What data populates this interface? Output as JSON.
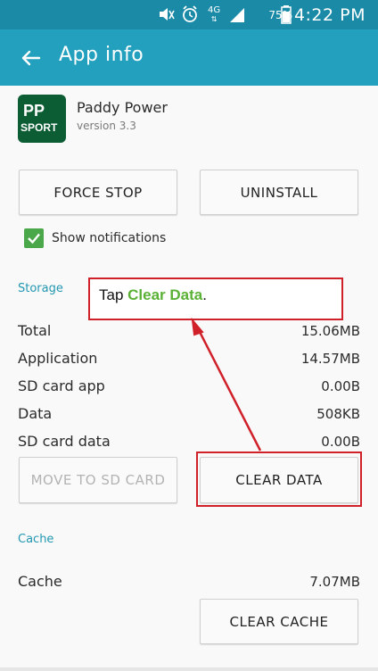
{
  "status_bar": {
    "time": "4:22 PM",
    "battery_percent": "75%",
    "network": "4G",
    "icons": [
      "mute-icon",
      "alarm-icon",
      "network-4g-icon",
      "signal-icon",
      "battery-icon"
    ]
  },
  "app_bar": {
    "title": "App info",
    "back_icon": "arrow-left-icon",
    "background": "#22a0bd"
  },
  "app": {
    "name": "Paddy Power",
    "version": "version 3.3",
    "icon_text_top": "PP",
    "icon_text_bottom": "SPORT",
    "icon_color": "#0c5d34"
  },
  "buttons": {
    "force_stop": "FORCE STOP",
    "uninstall": "UNINSTALL",
    "move_to_sd": "MOVE TO SD CARD",
    "clear_data": "CLEAR DATA",
    "clear_cache": "CLEAR CACHE"
  },
  "notifications": {
    "label": "Show notifications",
    "checked": true
  },
  "storage": {
    "section_label": "Storage",
    "rows": [
      {
        "label": "Total",
        "value": "15.06MB"
      },
      {
        "label": "Application",
        "value": "14.57MB"
      },
      {
        "label": "SD card app",
        "value": "0.00B"
      },
      {
        "label": "Data",
        "value": "508KB"
      },
      {
        "label": "SD card data",
        "value": "0.00B"
      }
    ]
  },
  "cache": {
    "section_label": "Cache",
    "rows": [
      {
        "label": "Cache",
        "value": "7.07MB"
      }
    ]
  },
  "annotation": {
    "prefix": "Tap ",
    "highlight": "Clear Data",
    "suffix": ".",
    "highlight_color": "#5ab136",
    "border_color": "#d0212a"
  }
}
